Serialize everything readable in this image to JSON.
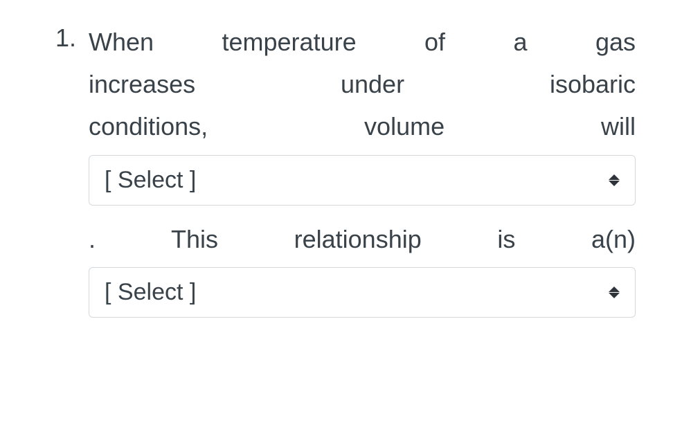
{
  "question": {
    "number": "1.",
    "line1": "When temperature of a gas",
    "line2": "increases under isobaric",
    "line3": "conditions, volume will",
    "select1_placeholder": "[ Select ]",
    "line4": ". This relationship is a(n)",
    "select2_placeholder": "[ Select ]"
  }
}
